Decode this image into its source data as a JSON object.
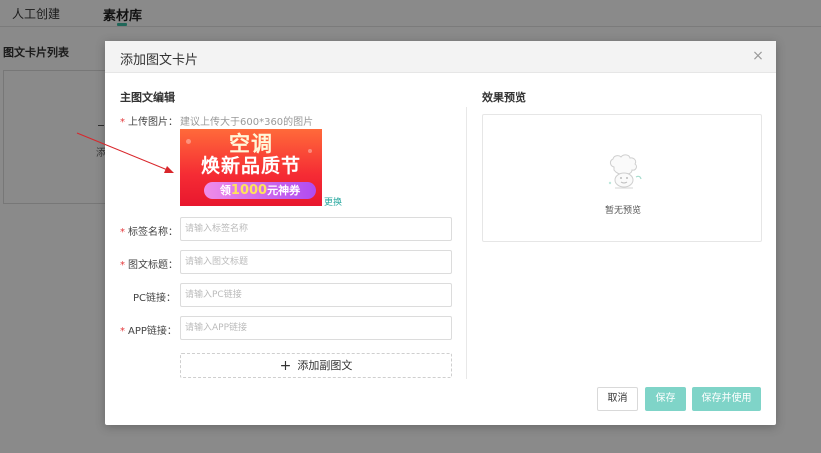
{
  "background": {
    "tabs": [
      {
        "label": "人工创建"
      },
      {
        "label": "素材库"
      }
    ],
    "list_title": "图文卡片列表",
    "card_fragment_text": "添"
  },
  "modal": {
    "title": "添加图文卡片",
    "close_glyph": "×",
    "left_section_title": "主图文编辑",
    "right_section_title": "效果预览",
    "upload": {
      "label": "上传图片：",
      "hint": "建议上传大于600*360的图片",
      "banner_line1": "空调",
      "banner_line2": "焕新品质节",
      "banner_pill_prefix": "领",
      "banner_pill_amount": "1000",
      "banner_pill_suffix": "元神券",
      "replace_label": "更换"
    },
    "fields": [
      {
        "label": "标签名称：",
        "required": true,
        "placeholder": "请输入标签名称",
        "value": ""
      },
      {
        "label": "图文标题：",
        "required": true,
        "placeholder": "请输入图文标题",
        "value": ""
      },
      {
        "label": "PC链接：",
        "required": false,
        "placeholder": "请输入PC链接",
        "value": ""
      },
      {
        "label": "APP链接：",
        "required": true,
        "placeholder": "请输入APP链接",
        "value": ""
      }
    ],
    "required_mark": "*",
    "add_sub_label": "添加副图文",
    "add_sub_icon": "+",
    "preview_empty": "暂无预览",
    "buttons": {
      "cancel": "取消",
      "save": "保存",
      "save_and_use": "保存并使用"
    }
  },
  "colors": {
    "accent": "#3bbfa4",
    "button_teal": "#7fd4c8",
    "required": "#e4393c",
    "annotation_arrow": "#d9262b"
  },
  "icons": {
    "close": "close-icon",
    "plus": "plus-icon",
    "empty_preview": "empty-preview-illustration"
  }
}
